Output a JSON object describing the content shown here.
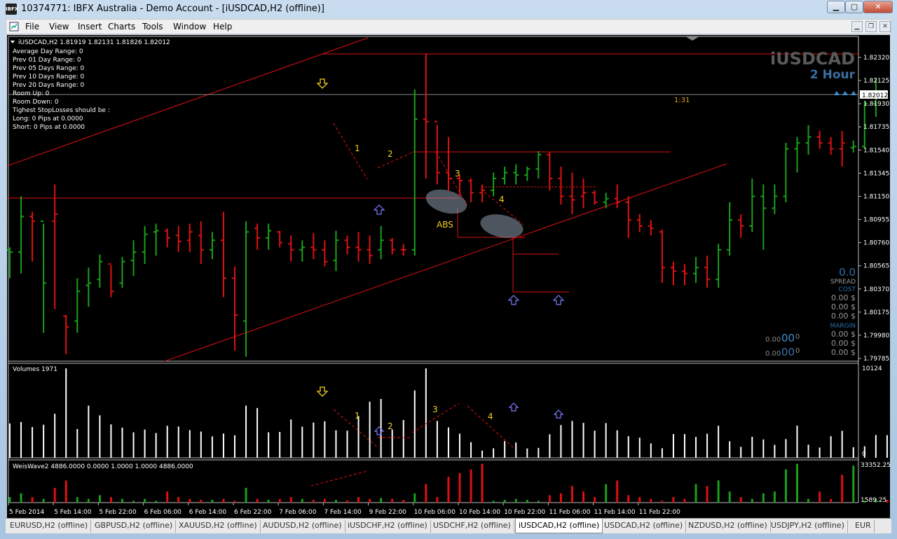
{
  "window": {
    "title": "10374771: IBFX Australia - Demo Account - [iUSDCAD,H2 (offline)]",
    "app_icon": "IBFX"
  },
  "menu": [
    "File",
    "View",
    "Insert",
    "Charts",
    "Tools",
    "Window",
    "Help"
  ],
  "chart": {
    "header": "iUSDCAD,H2  1.81919 1.82131 1.81826 1.82012",
    "info_lines": [
      "Average Day  Range: 0",
      "Prev 01  Day  Range: 0",
      "Prev 05  Days Range: 0",
      "Prev 10  Days Range: 0",
      "Prev 20  Days Range: 0",
      "Room Up:      0",
      "Room Down: 0",
      "Tighest StopLosses should be :",
      "Long:  0 Pips at 0.0000",
      "Short: 0 Pips at 0.0000"
    ],
    "symbol_watermark": "iUSDCAD",
    "timeframe_watermark": "2 Hour",
    "price_labels": [
      "1.82320",
      "1.82125",
      "1.81930",
      "1.81735",
      "1.81540",
      "1.81345",
      "1.81150",
      "1.80955",
      "1.80760",
      "1.80565",
      "1.80370",
      "1.80175",
      "1.79980",
      "1.79785"
    ],
    "current_price": "1.82012",
    "timer": "1:31",
    "wave_labels": [
      "1",
      "2",
      "3",
      "4"
    ],
    "abs_label": "ABS",
    "spread": {
      "value": "0.0",
      "label": "SPREAD",
      "cost_label": "COST",
      "cost_values": [
        "0.00 $",
        "0.00 $",
        "0.00 $"
      ],
      "margin_label": "MARGIN",
      "margin_values": [
        "0.00 $",
        "0.00 $",
        "0.00 $"
      ]
    },
    "small_readouts": [
      {
        "small": "0.00",
        "big": "00",
        "tail": "0"
      },
      {
        "small": "0.00",
        "big": "00",
        "tail": "0"
      }
    ],
    "colors": {
      "bull": "#1aa01a",
      "bear": "#e01010",
      "line": "#e01010",
      "wave": "#f5d020",
      "arrow": "#7b7bff",
      "watermark": "#5a5a5a",
      "watermark2": "#3a6fa0"
    }
  },
  "volumes": {
    "header": "Volumes 1971",
    "max_label": "10124",
    "min_label": "0",
    "wave_labels": [
      "1",
      "2",
      "3",
      "4"
    ]
  },
  "weiswave": {
    "header": "WeisWave2 4886.0000 0.0000 1.0000 1.0000 4886.0000",
    "max_label": "33352.25",
    "min_label": "1589.25"
  },
  "time_labels": [
    "5 Feb 2014",
    "5 Feb 14:00",
    "5 Feb 22:00",
    "6 Feb 06:00",
    "6 Feb 14:00",
    "6 Feb 22:00",
    "7 Feb 06:00",
    "7 Feb 14:00",
    "9 Feb 22:00",
    "10 Feb 06:00",
    "10 Feb 14:00",
    "10 Feb 22:00",
    "11 Feb 06:00",
    "11 Feb 14:00",
    "11 Feb 22:00"
  ],
  "tabs": [
    {
      "label": "EURUSD,H2 (offline)",
      "active": false
    },
    {
      "label": "GBPUSD,H2 (offline)",
      "active": false
    },
    {
      "label": "XAUUSD,H2 (offline)",
      "active": false
    },
    {
      "label": "AUDUSD,H2 (offline)",
      "active": false
    },
    {
      "label": "iUSDCHF,H2 (offline)",
      "active": false
    },
    {
      "label": "USDCHF,H2 (offline)",
      "active": false
    },
    {
      "label": "iUSDCAD,H2 (offline)",
      "active": true
    },
    {
      "label": "USDCAD,H2 (offline)",
      "active": false
    },
    {
      "label": "NZDUSD,H2 (offline)",
      "active": false
    },
    {
      "label": "USDJPY,H2 (offline)",
      "active": false
    },
    {
      "label": "EUR",
      "active": false
    }
  ],
  "bars": [
    [
      1.807,
      1.8072,
      1.8046,
      1.8068,
      "G"
    ],
    [
      1.8068,
      1.8115,
      1.805,
      1.8098,
      "G"
    ],
    [
      1.8098,
      1.8102,
      1.806,
      1.8094,
      "R"
    ],
    [
      1.8094,
      1.8092,
      1.8,
      1.8042,
      "G"
    ],
    [
      1.8094,
      1.8125,
      1.802,
      1.81,
      "R"
    ],
    [
      1.8014,
      1.8015,
      1.7982,
      1.8005,
      "R"
    ],
    [
      1.801,
      1.8046,
      1.8,
      1.8035,
      "G"
    ],
    [
      1.804,
      1.8055,
      1.8022,
      1.8042,
      "G"
    ],
    [
      1.8045,
      1.8066,
      1.8038,
      1.806,
      "G"
    ],
    [
      1.8058,
      1.8057,
      1.803,
      1.8035,
      "R"
    ],
    [
      1.8042,
      1.8064,
      1.8038,
      1.806,
      "G"
    ],
    [
      1.8061,
      1.8078,
      1.8048,
      1.8068,
      "G"
    ],
    [
      1.8068,
      1.809,
      1.8058,
      1.8083,
      "G"
    ],
    [
      1.8085,
      1.8092,
      1.8065,
      1.8086,
      "G"
    ],
    [
      1.8086,
      1.8088,
      1.8072,
      1.808,
      "R"
    ],
    [
      1.8082,
      1.809,
      1.8068,
      1.8077,
      "R"
    ],
    [
      1.8078,
      1.8092,
      1.8068,
      1.8085,
      "R"
    ],
    [
      1.8082,
      1.8094,
      1.8058,
      1.807,
      "R"
    ],
    [
      1.807,
      1.8085,
      1.8062,
      1.8078,
      "G"
    ],
    [
      1.8078,
      1.8102,
      1.803,
      1.8046,
      "R"
    ],
    [
      1.8046,
      1.8056,
      1.7985,
      1.8015,
      "R"
    ],
    [
      1.801,
      1.8094,
      1.798,
      1.8085,
      "G"
    ],
    [
      1.8088,
      1.8092,
      1.807,
      1.808,
      "R"
    ],
    [
      1.808,
      1.8092,
      1.807,
      1.8086,
      "G"
    ],
    [
      1.8085,
      1.8086,
      1.8072,
      1.8076,
      "R"
    ],
    [
      1.8075,
      1.8082,
      1.806,
      1.807,
      "R"
    ],
    [
      1.807,
      1.8078,
      1.806,
      1.8072,
      "G"
    ],
    [
      1.8072,
      1.8084,
      1.8062,
      1.807,
      "R"
    ],
    [
      1.807,
      1.8078,
      1.8056,
      1.806,
      "R"
    ],
    [
      1.8061,
      1.8086,
      1.8052,
      1.8078,
      "G"
    ],
    [
      1.8078,
      1.8082,
      1.8066,
      1.8072,
      "R"
    ],
    [
      1.8072,
      1.8085,
      1.806,
      1.807,
      "R"
    ],
    [
      1.807,
      1.8082,
      1.8058,
      1.8065,
      "R"
    ],
    [
      1.807,
      1.809,
      1.8062,
      1.8078,
      "G"
    ],
    [
      1.8078,
      1.808,
      1.8066,
      1.807,
      "R"
    ],
    [
      1.807,
      1.8075,
      1.8065,
      1.807,
      "R"
    ],
    [
      1.807,
      1.8205,
      1.8065,
      1.818,
      "G"
    ],
    [
      1.818,
      1.8235,
      1.813,
      1.8178,
      "R"
    ],
    [
      1.8178,
      1.8175,
      1.8125,
      1.8135,
      "R"
    ],
    [
      1.8135,
      1.8165,
      1.812,
      1.813,
      "R"
    ],
    [
      1.813,
      1.8133,
      1.8115,
      1.8128,
      "R"
    ],
    [
      1.8128,
      1.813,
      1.811,
      1.8118,
      "R"
    ],
    [
      1.8118,
      1.8125,
      1.811,
      1.812,
      "R"
    ],
    [
      1.812,
      1.8135,
      1.8115,
      1.813,
      "G"
    ],
    [
      1.813,
      1.814,
      1.8125,
      1.8135,
      "G"
    ],
    [
      1.8135,
      1.8142,
      1.8125,
      1.8133,
      "G"
    ],
    [
      1.8133,
      1.814,
      1.8128,
      1.8138,
      "G"
    ],
    [
      1.8138,
      1.8153,
      1.813,
      1.815,
      "G"
    ],
    [
      1.815,
      1.8152,
      1.812,
      1.813,
      "R"
    ],
    [
      1.813,
      1.814,
      1.8108,
      1.8115,
      "R"
    ],
    [
      1.8115,
      1.8135,
      1.81,
      1.8112,
      "R"
    ],
    [
      1.8115,
      1.813,
      1.8105,
      1.8118,
      "R"
    ],
    [
      1.8118,
      1.812,
      1.8108,
      1.811,
      "R"
    ],
    [
      1.811,
      1.8118,
      1.8105,
      1.8113,
      "G"
    ],
    [
      1.8113,
      1.8125,
      1.8105,
      1.811,
      "R"
    ],
    [
      1.811,
      1.8115,
      1.808,
      1.8095,
      "R"
    ],
    [
      1.8095,
      1.81,
      1.8085,
      1.809,
      "R"
    ],
    [
      1.809,
      1.8095,
      1.8082,
      1.8088,
      "R"
    ],
    [
      1.8085,
      1.8087,
      1.8042,
      1.8055,
      "R"
    ],
    [
      1.8055,
      1.806,
      1.804,
      1.8052,
      "R"
    ],
    [
      1.8052,
      1.8058,
      1.804,
      1.805,
      "R"
    ],
    [
      1.805,
      1.8064,
      1.8042,
      1.8055,
      "G"
    ],
    [
      1.8055,
      1.8065,
      1.8038,
      1.8045,
      "R"
    ],
    [
      1.8045,
      1.8075,
      1.8038,
      1.807,
      "G"
    ],
    [
      1.807,
      1.811,
      1.8065,
      1.8095,
      "G"
    ],
    [
      1.8095,
      1.81,
      1.808,
      1.809,
      "R"
    ],
    [
      1.809,
      1.813,
      1.8085,
      1.8115,
      "G"
    ],
    [
      1.8115,
      1.8125,
      1.807,
      1.8105,
      "G"
    ],
    [
      1.8105,
      1.8125,
      1.81,
      1.8115,
      "G"
    ],
    [
      1.8115,
      1.816,
      1.811,
      1.8155,
      "G"
    ],
    [
      1.8155,
      1.8165,
      1.8135,
      1.816,
      "G"
    ],
    [
      1.816,
      1.8175,
      1.815,
      1.8165,
      "G"
    ],
    [
      1.8165,
      1.817,
      1.8155,
      1.816,
      "R"
    ],
    [
      1.816,
      1.8165,
      1.815,
      1.8155,
      "R"
    ],
    [
      1.8155,
      1.817,
      1.814,
      1.816,
      "R"
    ],
    [
      1.8156,
      1.8162,
      1.8152,
      1.8157,
      "G"
    ],
    [
      1.8157,
      1.8195,
      1.8155,
      1.8193,
      "G"
    ],
    [
      1.8193,
      1.8215,
      1.8182,
      1.82012,
      "G"
    ]
  ],
  "volume_values": [
    3820,
    3980,
    3420,
    3680,
    4900,
    9950,
    3200,
    5800,
    4720,
    3720,
    3360,
    2840,
    3140,
    2760,
    3560,
    3480,
    3080,
    2920,
    2380,
    2700,
    2500,
    5800,
    5540,
    2840,
    2880,
    4260,
    3460,
    3920,
    4060,
    3060,
    3020,
    4620,
    6240,
    6540,
    3140,
    4200,
    7500,
    9950,
    4100,
    3380,
    2680,
    1740,
    800,
    1060,
    1860,
    1700,
    1040,
    1100,
    2620,
    3640,
    4100,
    3880,
    3020,
    3860,
    3060,
    2400,
    2240,
    1600,
    1060,
    2640,
    2640,
    2320,
    2680,
    3560,
    1840,
    1220,
    2340,
    2040,
    1440,
    2080,
    3580,
    1460,
    1140,
    2400,
    3000,
    1180,
    1280,
    2540,
    2520,
    2080
  ],
  "weis_values": [
    3000,
    5000,
    3000,
    2000,
    8000,
    12000,
    3000,
    2000,
    4000,
    3000,
    2000,
    1000,
    2000,
    1000,
    6000,
    3000,
    2000,
    1500,
    1500,
    2000,
    1000,
    8000,
    2000,
    1500,
    2000,
    3000,
    2000,
    1500,
    2000,
    1500,
    1200,
    3000,
    2000,
    2500,
    2000,
    1500,
    5000,
    10000,
    3000,
    14000,
    16000,
    18000,
    21000,
    1000,
    1500,
    2000,
    1500,
    1000,
    4000,
    5000,
    9000,
    6000,
    3000,
    10000,
    12000,
    4000,
    3000,
    2000,
    1000,
    3000,
    2000,
    10000,
    9000,
    12000,
    6000,
    3000,
    2000,
    5000,
    6000,
    18000,
    21000,
    2000,
    6000,
    2000,
    15000,
    20000,
    1000,
    2000,
    1500,
    1000,
    3000
  ]
}
